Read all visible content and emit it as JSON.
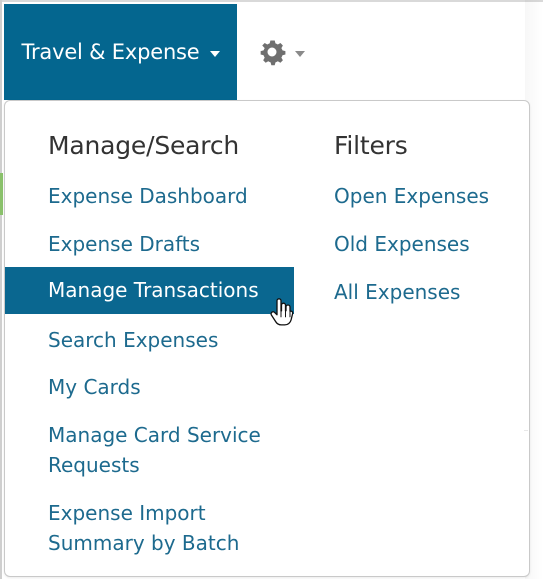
{
  "nav": {
    "main_menu_label": "Travel & Expense",
    "settings_icon": "gear-icon",
    "caret_icon": "chevron-down-icon"
  },
  "menu": {
    "manage_search": {
      "heading": "Manage/Search",
      "items": [
        "Expense Dashboard",
        "Expense Drafts",
        "Manage Transactions",
        "Search Expenses",
        "My Cards",
        "Manage Card Service Requests",
        "Expense Import Summary by Batch"
      ]
    },
    "filters": {
      "heading": "Filters",
      "items": [
        "Open Expenses",
        "Old Expenses",
        "All Expenses"
      ]
    }
  },
  "colors": {
    "nav_bg": "#04668f",
    "active_bg": "#0a6790",
    "link": "#1d6a8e",
    "heading": "#333333",
    "menu_border": "#c9c9c9"
  },
  "cursor": {
    "icon": "hand-pointer-icon"
  }
}
